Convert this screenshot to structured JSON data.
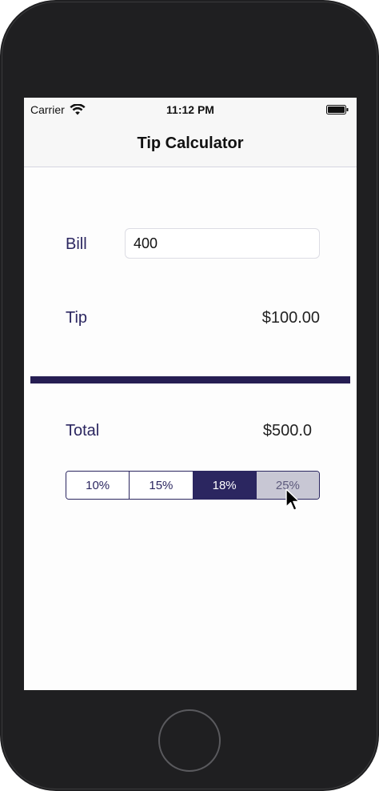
{
  "status_bar": {
    "carrier": "Carrier",
    "time": "11:12 PM"
  },
  "nav": {
    "title": "Tip Calculator"
  },
  "bill": {
    "label": "Bill",
    "value": "400"
  },
  "tip": {
    "label": "Tip",
    "value": "$100.00"
  },
  "total": {
    "label": "Total",
    "value": "$500.0"
  },
  "tip_options": {
    "items": [
      {
        "label": "10%"
      },
      {
        "label": "15%"
      },
      {
        "label": "18%"
      },
      {
        "label": "25%"
      }
    ],
    "selected": "18%",
    "pressed": "25%"
  },
  "colors": {
    "accent": "#2b2660",
    "divider": "#261e53",
    "device_body": "#1f1f21"
  },
  "icons": {
    "wifi": "wifi-icon",
    "battery": "battery-icon",
    "cursor": "mouse-pointer-icon"
  }
}
